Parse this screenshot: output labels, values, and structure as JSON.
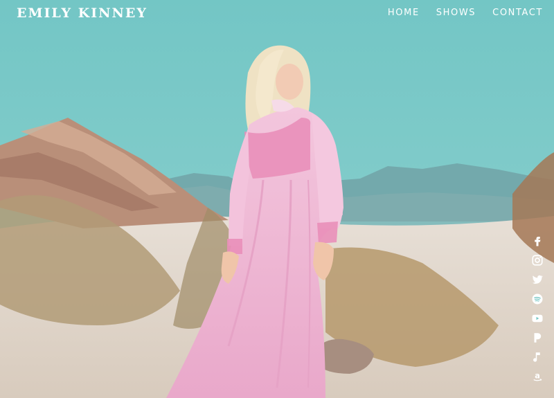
{
  "site": {
    "logo": "EMILY KINNEY"
  },
  "nav": {
    "items": [
      {
        "label": "HOME"
      },
      {
        "label": "SHOWS"
      },
      {
        "label": "CONTACT"
      }
    ]
  },
  "social": {
    "icons": [
      "facebook-icon",
      "instagram-icon",
      "twitter-icon",
      "spotify-icon",
      "youtube-icon",
      "pandora-icon",
      "music-note-icon",
      "amazon-icon"
    ]
  },
  "colors": {
    "sky": "#79c8c6",
    "ground": "#e7ddd1",
    "dress": "#f0b8d5",
    "text": "#ffffff"
  }
}
